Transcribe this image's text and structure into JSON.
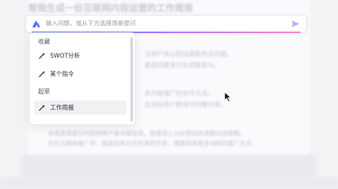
{
  "background": {
    "title": "帮我生成一份互联网内容运营的工作周报",
    "lines": [
      "注用户关心的话题和热点问题，",
      "者提供更多行业洞察参与。",
      "多内容推广的合作方式。",
      "在目标用户群体中的曝光率。",
      "本周发现部分内容的用户参与度较低，需要深入分析原因并调整内容策略。",
      "在社交媒体推广中，面临竞争对手的激烈竞争，需要探索更多创新的推广方式。"
    ]
  },
  "input": {
    "placeholder": "输入问题，或从下方选择场景提问"
  },
  "dropdown": {
    "sections": [
      {
        "label": "收藏",
        "items": [
          {
            "label": "SWOT分析",
            "icon": "sparkle-pen-icon"
          },
          {
            "label": "某个指令",
            "icon": "sparkle-pen-icon"
          }
        ]
      },
      {
        "label": "起草",
        "items": [
          {
            "label": "工作周报",
            "icon": "sparkle-pen-icon"
          }
        ]
      }
    ]
  },
  "colors": {
    "accent_blue": "#3d6bff",
    "accent_purple": "#a46cff",
    "send_icon": "#c6a6ff"
  }
}
